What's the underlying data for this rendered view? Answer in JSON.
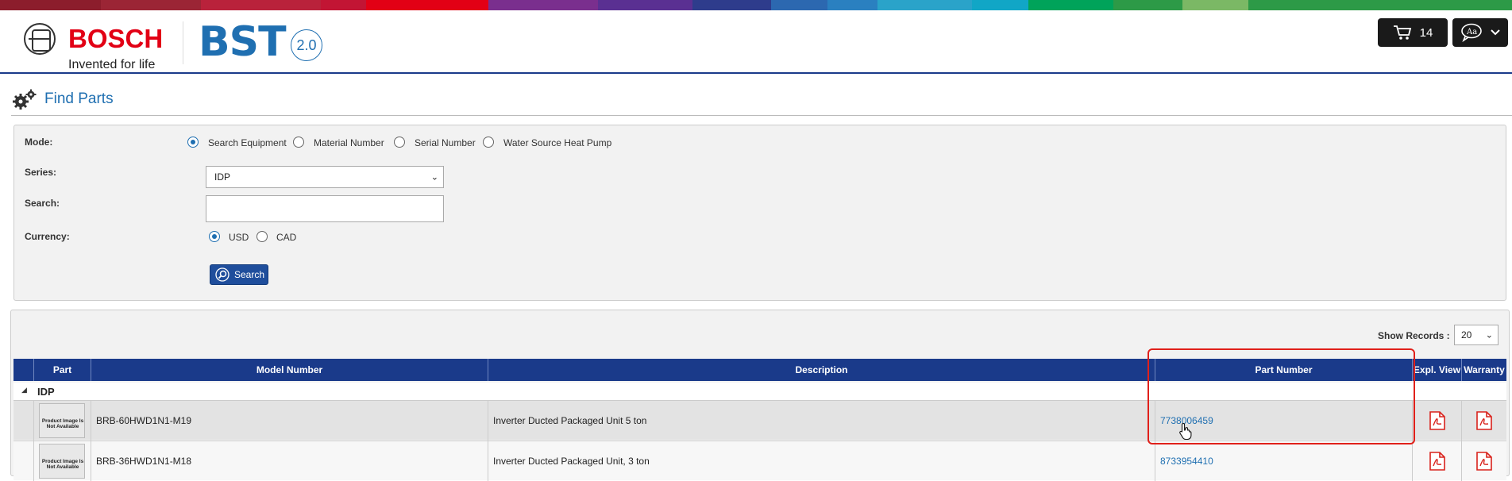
{
  "stripe_colors": [
    "#8c1d2c",
    "#b9223b",
    "#e20015",
    "#c3135b",
    "#7a2f8e",
    "#4a2f8a",
    "#2a3d8f",
    "#2c68b0",
    "#2a8ec9",
    "#2aa7c9",
    "#11a0a0",
    "#00a35a",
    "#7bb865",
    "#2d9a47",
    "#1d7a3a"
  ],
  "header": {
    "brand": "BOSCH",
    "tagline": "Invented for life",
    "app_name": "BST",
    "app_version": "2.0",
    "cart_count": "14"
  },
  "page": {
    "title": "Find Parts"
  },
  "form": {
    "mode_label": "Mode:",
    "modes": [
      "Search Equipment",
      "Material Number",
      "Serial Number",
      "Water Source Heat Pump"
    ],
    "mode_selected": "Search Equipment",
    "series_label": "Series:",
    "series_value": "IDP",
    "search_label": "Search:",
    "search_value": "",
    "currency_label": "Currency:",
    "currencies": [
      "USD",
      "CAD"
    ],
    "currency_selected": "USD",
    "search_button": "Search"
  },
  "results": {
    "show_records_label": "Show Records :",
    "show_records_value": "20",
    "columns": [
      "Part",
      "Model Number",
      "Description",
      "Part Number",
      "Expl. View",
      "Warranty"
    ],
    "group": "IDP",
    "no_image_text": "Product Image Is Not Available",
    "rows": [
      {
        "model": "BRB-60HWD1N1-M19",
        "description": "Inverter Ducted Packaged Unit 5 ton",
        "part_number": "7738006459"
      },
      {
        "model": "BRB-36HWD1N1-M18",
        "description": "Inverter Ducted Packaged Unit, 3 ton",
        "part_number": "8733954410"
      }
    ]
  },
  "colors": {
    "header_blue": "#1a3a8a",
    "link_blue": "#1f6fb1",
    "bosch_red": "#e20015",
    "highlight_red": "#e0201a",
    "pdf_red": "#d9221c"
  }
}
